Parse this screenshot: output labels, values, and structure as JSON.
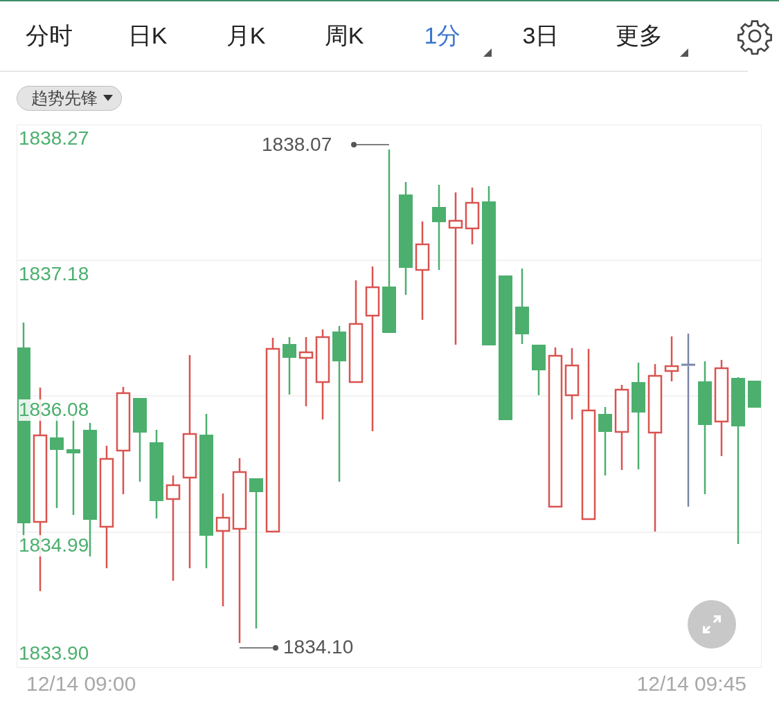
{
  "tabs": [
    {
      "label": "分时",
      "selected": false,
      "has_menu": false
    },
    {
      "label": "日K",
      "selected": false,
      "has_menu": false
    },
    {
      "label": "月K",
      "selected": false,
      "has_menu": false
    },
    {
      "label": "周K",
      "selected": false,
      "has_menu": false
    },
    {
      "label": "1分",
      "selected": true,
      "has_menu": true
    },
    {
      "label": "3日",
      "selected": false,
      "has_menu": false
    },
    {
      "label": "更多",
      "selected": false,
      "has_menu": true
    }
  ],
  "indicator_dropdown": {
    "label": "趋势先锋"
  },
  "chart": {
    "y_labels": [
      "1838.27",
      "1837.18",
      "1836.08",
      "1834.99",
      "1833.90"
    ],
    "high_marker": "1838.07",
    "low_marker": "1834.10",
    "x_labels": [
      "12/14 09:00",
      "12/14 09:45"
    ]
  }
}
